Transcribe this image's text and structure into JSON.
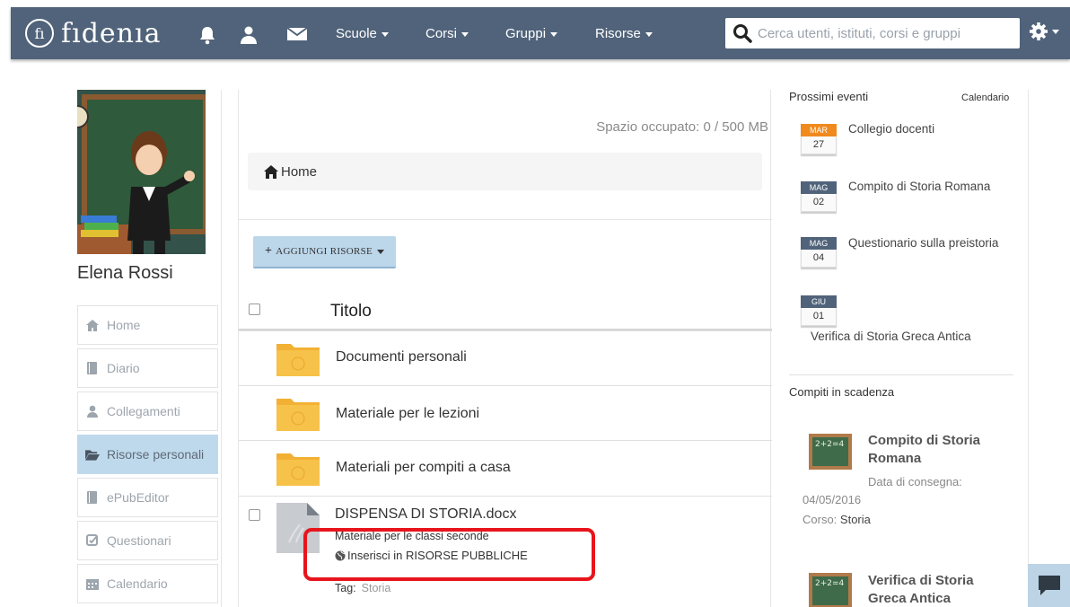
{
  "navbar": {
    "logo_mark": "fı",
    "logo_text": "fıdenıa",
    "menus": [
      {
        "label": "Scuole"
      },
      {
        "label": "Corsi"
      },
      {
        "label": "Gruppi"
      },
      {
        "label": "Risorse"
      }
    ],
    "search_placeholder": "Cerca utenti, istituti, corsi e gruppi",
    "bar_color": "#50637a"
  },
  "profile": {
    "name": "Elena Rossi"
  },
  "sidebar": {
    "items": [
      {
        "label": "Home",
        "icon": "home-icon"
      },
      {
        "label": "Diario",
        "icon": "book-icon"
      },
      {
        "label": "Collegamenti",
        "icon": "user-icon"
      },
      {
        "label": "Risorse personali",
        "icon": "folder-open-icon",
        "active": true
      },
      {
        "label": "ePubEditor",
        "icon": "book-icon"
      },
      {
        "label": "Questionari",
        "icon": "checkbox-icon"
      },
      {
        "label": "Calendario",
        "icon": "calendar-icon"
      }
    ],
    "active_color": "#bfd9ec"
  },
  "main": {
    "space_used": "Spazio occupato: 0 / 500 MB",
    "breadcrumb": "Home",
    "add_button": "AGGIUNGI RISORSE",
    "column_title": "Titolo",
    "folders": [
      {
        "name": "Documenti personali"
      },
      {
        "name": "Materiale per le lezioni"
      },
      {
        "name": "Materiali per compiti a casa"
      }
    ],
    "file": {
      "name": "DISPENSA DI STORIA.docx",
      "description": "Materiale per le classi seconde",
      "publish_link": "Inserisci in RISORSE PUBBLICHE",
      "tag_label": "Tag:",
      "tag_value": "Storia"
    },
    "highlight_color": "#e8141c"
  },
  "events": {
    "title": "Prossimi eventi",
    "calendar_link": "Calendario",
    "items": [
      {
        "month": "MAR",
        "day": "27",
        "title": "Collegio docenti",
        "month_color": "#f0891e"
      },
      {
        "month": "MAG",
        "day": "02",
        "title": "Compito di Storia Romana",
        "month_color": "#50637a"
      },
      {
        "month": "MAG",
        "day": "04",
        "title": "Questionario sulla preistoria",
        "month_color": "#50637a"
      },
      {
        "month": "GIU",
        "day": "01",
        "title": "Verifica di Storia Greca Antica",
        "month_color": "#50637a"
      }
    ]
  },
  "tasks": {
    "title": "Compiti in scadenza",
    "items": [
      {
        "title": "Compito di Storia Romana",
        "due_label": "Data di consegna:",
        "due_date": "04/05/2016",
        "course_label": "Corso:",
        "course": "Storia",
        "board_text": "2+2=4"
      },
      {
        "title": "Verifica di Storia Greca Antica",
        "board_text": "2+2=4"
      }
    ]
  }
}
